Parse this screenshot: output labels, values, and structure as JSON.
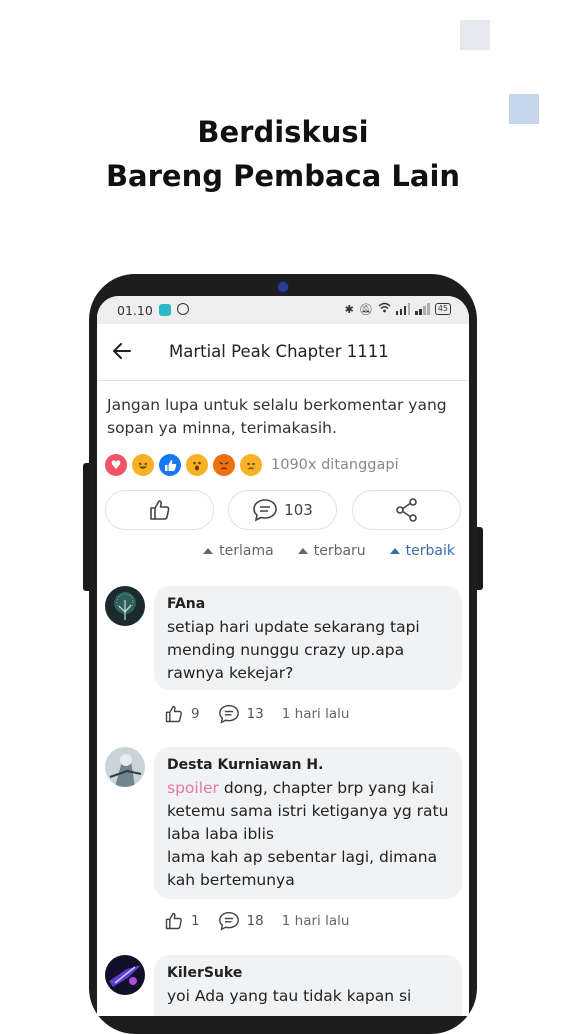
{
  "headline": {
    "line1": "Berdiskusi",
    "line2": "Bareng Pembaca Lain"
  },
  "status_bar": {
    "time": "01.10",
    "battery": "45"
  },
  "app_bar": {
    "title": "Martial Peak Chapter 1111"
  },
  "notice": "Jangan lupa untuk selalu berkomentar yang sopan ya minna, terimakasih.",
  "reactions": {
    "emojis": [
      "heart-icon",
      "laugh-icon",
      "like-icon",
      "wow-icon",
      "angry-icon",
      "sad-icon"
    ],
    "summary": "1090x ditanggapi"
  },
  "actions": {
    "comment_count": "103"
  },
  "sort": {
    "options": [
      "terlama",
      "terbaru",
      "terbaik"
    ],
    "active": "terbaik"
  },
  "comments": [
    {
      "name": "FAna",
      "text_lines": [
        "setiap hari update sekarang tapi",
        "mending nunggu crazy up.apa",
        "rawnya kekejar?"
      ],
      "likes": "9",
      "replies": "13",
      "time": "1 hari lalu"
    },
    {
      "name": "Desta Kurniawan H.",
      "spoiler": "spoiler",
      "text_first_rest": " dong, chapter brp yang kai",
      "text_lines": [
        "ketemu sama istri ketiganya yg ratu",
        "laba laba iblis",
        "lama kah ap sebentar lagi, dimana",
        "kah bertemunya"
      ],
      "likes": "1",
      "replies": "18",
      "time": "1 hari lalu"
    },
    {
      "name": "KilerSuke",
      "text_lines": [
        "yoi Ada yang tau tidak kapan si"
      ]
    }
  ],
  "colors": {
    "accent": "#3a6ea8",
    "spoiler": "#e37aa1",
    "bubble": "#f1f2f4"
  }
}
